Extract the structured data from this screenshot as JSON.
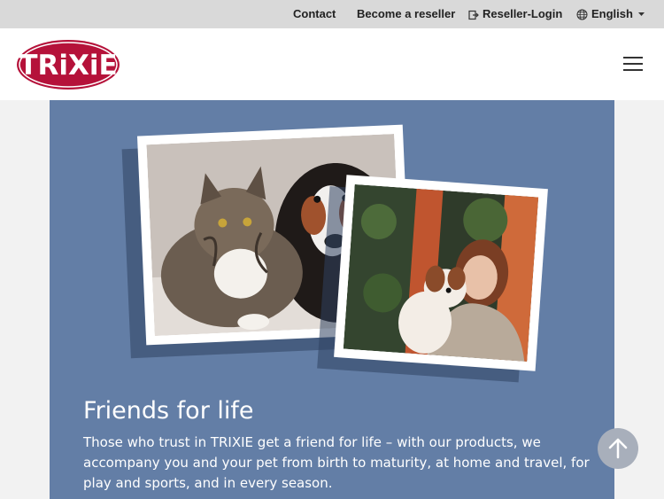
{
  "topbar": {
    "contact": "Contact",
    "reseller": "Become a reseller",
    "login": "Reseller-Login",
    "language": "English"
  },
  "header": {
    "logo_text": "TRiXiE"
  },
  "hero": {
    "title": "Friends for life",
    "text": "Those who trust in TRIXIE get a friend for life – with our products, we accompany you and your pet from birth to maturity, at home and travel, for play and sports, and in every season."
  },
  "colors": {
    "brand_red": "#b5123a",
    "hero_bg": "#637ea6",
    "topbar_bg": "#d9d9d9"
  },
  "icons": [
    "login-icon",
    "globe-icon",
    "caret-down-icon",
    "menu-icon",
    "arrow-up-icon"
  ]
}
